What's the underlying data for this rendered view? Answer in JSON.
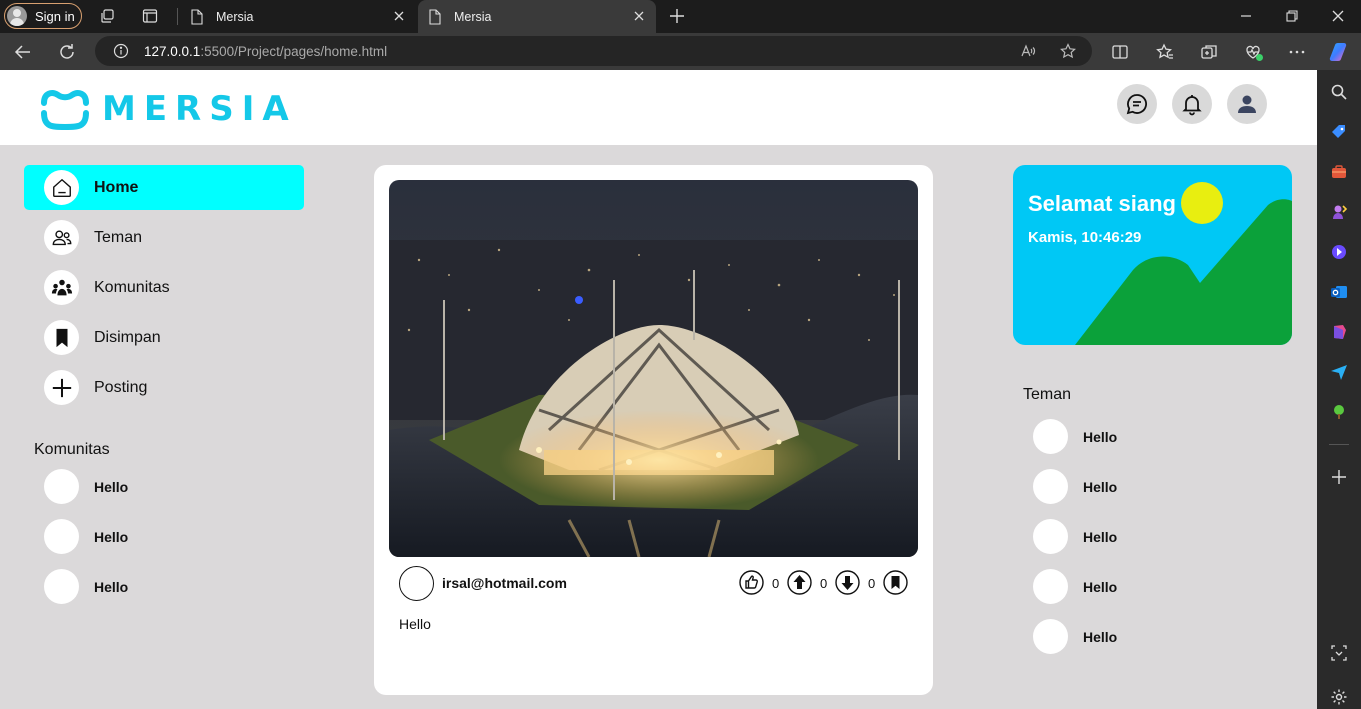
{
  "browser": {
    "signin_label": "Sign in",
    "tabs": [
      {
        "title": "Mersia",
        "active": false
      },
      {
        "title": "Mersia",
        "active": true
      }
    ],
    "url_host": "127.0.0.1",
    "url_rest": ":5500/Project/pages/home.html"
  },
  "brand": {
    "name": "MERSIA",
    "color": "#14c8e8"
  },
  "sidebar": {
    "menu": [
      {
        "label": "Home",
        "icon": "home-icon",
        "active": true
      },
      {
        "label": "Teman",
        "icon": "friends-icon",
        "active": false
      },
      {
        "label": "Komunitas",
        "icon": "community-icon",
        "active": false
      },
      {
        "label": "Disimpan",
        "icon": "bookmark-icon",
        "active": false
      },
      {
        "label": "Posting",
        "icon": "plus-icon",
        "active": false
      }
    ],
    "communities_title": "Komunitas",
    "communities": [
      {
        "name": "Hello"
      },
      {
        "name": "Hello"
      },
      {
        "name": "Hello"
      }
    ]
  },
  "post": {
    "image": "illuminated-mosque-at-night",
    "user": "irsal@hotmail.com",
    "likes": "0",
    "upvotes": "0",
    "downvotes": "0",
    "text": "Hello"
  },
  "greeting": {
    "title": "Selamat siang",
    "datetime": "Kamis, 10:46:29",
    "colors": {
      "sky": "#00c8f5",
      "sun": "#e8ee10",
      "hills": "#0ba13a"
    }
  },
  "friends": {
    "title": "Teman",
    "items": [
      {
        "name": "Hello"
      },
      {
        "name": "Hello"
      },
      {
        "name": "Hello"
      },
      {
        "name": "Hello"
      },
      {
        "name": "Hello"
      }
    ]
  },
  "colors": {
    "accent": "#00ffff",
    "page_bg": "#dbd9da"
  }
}
